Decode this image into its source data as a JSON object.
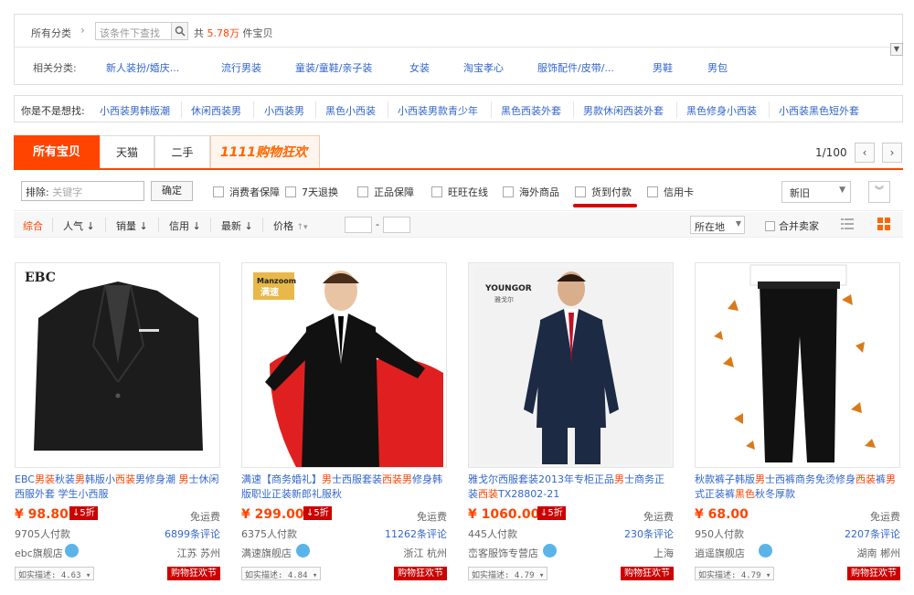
{
  "filter_box": {
    "all_categories": "所有分类",
    "search_placeholder": "该条件下查找",
    "total_prefix": "共",
    "total_num": "5.78万",
    "total_suffix": "件宝贝",
    "related_label": "相关分类:",
    "related": [
      "新人装扮/婚庆...",
      "流行男装",
      "童装/童鞋/亲子装",
      "女装",
      "淘宝孝心",
      "服饰配件/皮带/...",
      "男鞋",
      "男包"
    ]
  },
  "suggest": {
    "label": "你是不是想找:",
    "items": [
      "小西装男韩版潮",
      "休闲西装男",
      "小西装男",
      "黑色小西装",
      "小西装男款青少年",
      "黑色西装外套",
      "男款休闲西装外套",
      "黑色修身小西装",
      "小西装黑色短外套"
    ]
  },
  "tabs": {
    "all": "所有宝贝",
    "tmall": "天猫",
    "second": "二手",
    "promo": "1111购物狂欢节",
    "page": "1/100"
  },
  "filters": {
    "exclude_label": "排除:",
    "exclude_placeholder": "关键字",
    "ok": "确定",
    "checks": [
      "消费者保障",
      "7天退换",
      "正品保障",
      "旺旺在线",
      "海外商品",
      "货到付款",
      "信用卡"
    ],
    "sort_select": "新旧"
  },
  "sortbar": {
    "items": [
      "综合",
      "人气",
      "销量",
      "信用",
      "最新",
      "价格"
    ],
    "location": "所在地",
    "merge": "合并卖家"
  },
  "products": [
    {
      "title_parts": [
        "EBC",
        "男装",
        "秋装",
        "男",
        "韩版小",
        "西装",
        "男",
        "修身潮 ",
        "男",
        "士休闲西服外套 学生小西服"
      ],
      "price": "¥ 98.80",
      "disc": "↓5折",
      "ship": "免运费",
      "paid": "9705人付款",
      "reviews": "6899条评论",
      "shop": "ebc旗舰店",
      "loc": "江苏 苏州",
      "rate": "如实描述: 4.63",
      "badge": "购物狂欢节",
      "brand": "EBC"
    },
    {
      "title_parts": [
        "满速【商务婚礼】",
        "男",
        "士西服套装",
        "西装男",
        "修身韩版职业正装新郎礼服秋"
      ],
      "price": "¥ 299.00",
      "disc": "↓5折",
      "ship": "免运费",
      "paid": "6375人付款",
      "reviews": "11262条评论",
      "shop": "满速旗舰店",
      "loc": "浙江 杭州",
      "rate": "如实描述: 4.84",
      "badge": "购物狂欢节",
      "brand": "Manzoom 满速"
    },
    {
      "title_parts": [
        "雅戈尔西服套装2013年专柜正品",
        "男",
        "士商务正装",
        "西装",
        "TX28802-21"
      ],
      "price": "¥ 1060.00",
      "disc": "↓5折",
      "ship": "免运费",
      "paid": "445人付款",
      "reviews": "230条评论",
      "shop": "峦客服饰专营店",
      "loc": "上海",
      "rate": "如实描述: 4.79",
      "badge": "购物狂欢节",
      "brand": "YOUNGOR 雅戈尔"
    },
    {
      "title_parts": [
        "秋款裤子韩版",
        "男",
        "士西裤商务免烫修身",
        "西装",
        "裤",
        "男",
        "式正装裤",
        "黑色",
        "秋冬厚款"
      ],
      "price": "¥ 68.00",
      "disc": "",
      "ship": "免运费",
      "paid": "950人付款",
      "reviews": "2207条评论",
      "shop": "逍遥旗舰店",
      "loc": "湖南 郴州",
      "rate": "如实描述: 4.79",
      "badge": "购物狂欢节",
      "brand": ""
    }
  ]
}
